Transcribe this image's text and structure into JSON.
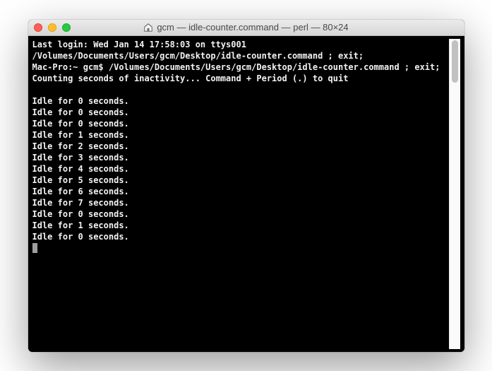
{
  "titlebar": {
    "title": "gcm — idle-counter.command — perl — 80×24"
  },
  "terminal": {
    "lines": [
      "Last login: Wed Jan 14 17:58:03 on ttys001",
      "/Volumes/Documents/Users/gcm/Desktop/idle-counter.command ; exit;",
      "Mac-Pro:~ gcm$ /Volumes/Documents/Users/gcm/Desktop/idle-counter.command ; exit;",
      "Counting seconds of inactivity... Command + Period (.) to quit",
      "",
      "Idle for 0 seconds.",
      "Idle for 0 seconds.",
      "Idle for 0 seconds.",
      "Idle for 1 seconds.",
      "Idle for 2 seconds.",
      "Idle for 3 seconds.",
      "Idle for 4 seconds.",
      "Idle for 5 seconds.",
      "Idle for 6 seconds.",
      "Idle for 7 seconds.",
      "Idle for 0 seconds.",
      "Idle for 1 seconds.",
      "Idle for 0 seconds."
    ]
  }
}
